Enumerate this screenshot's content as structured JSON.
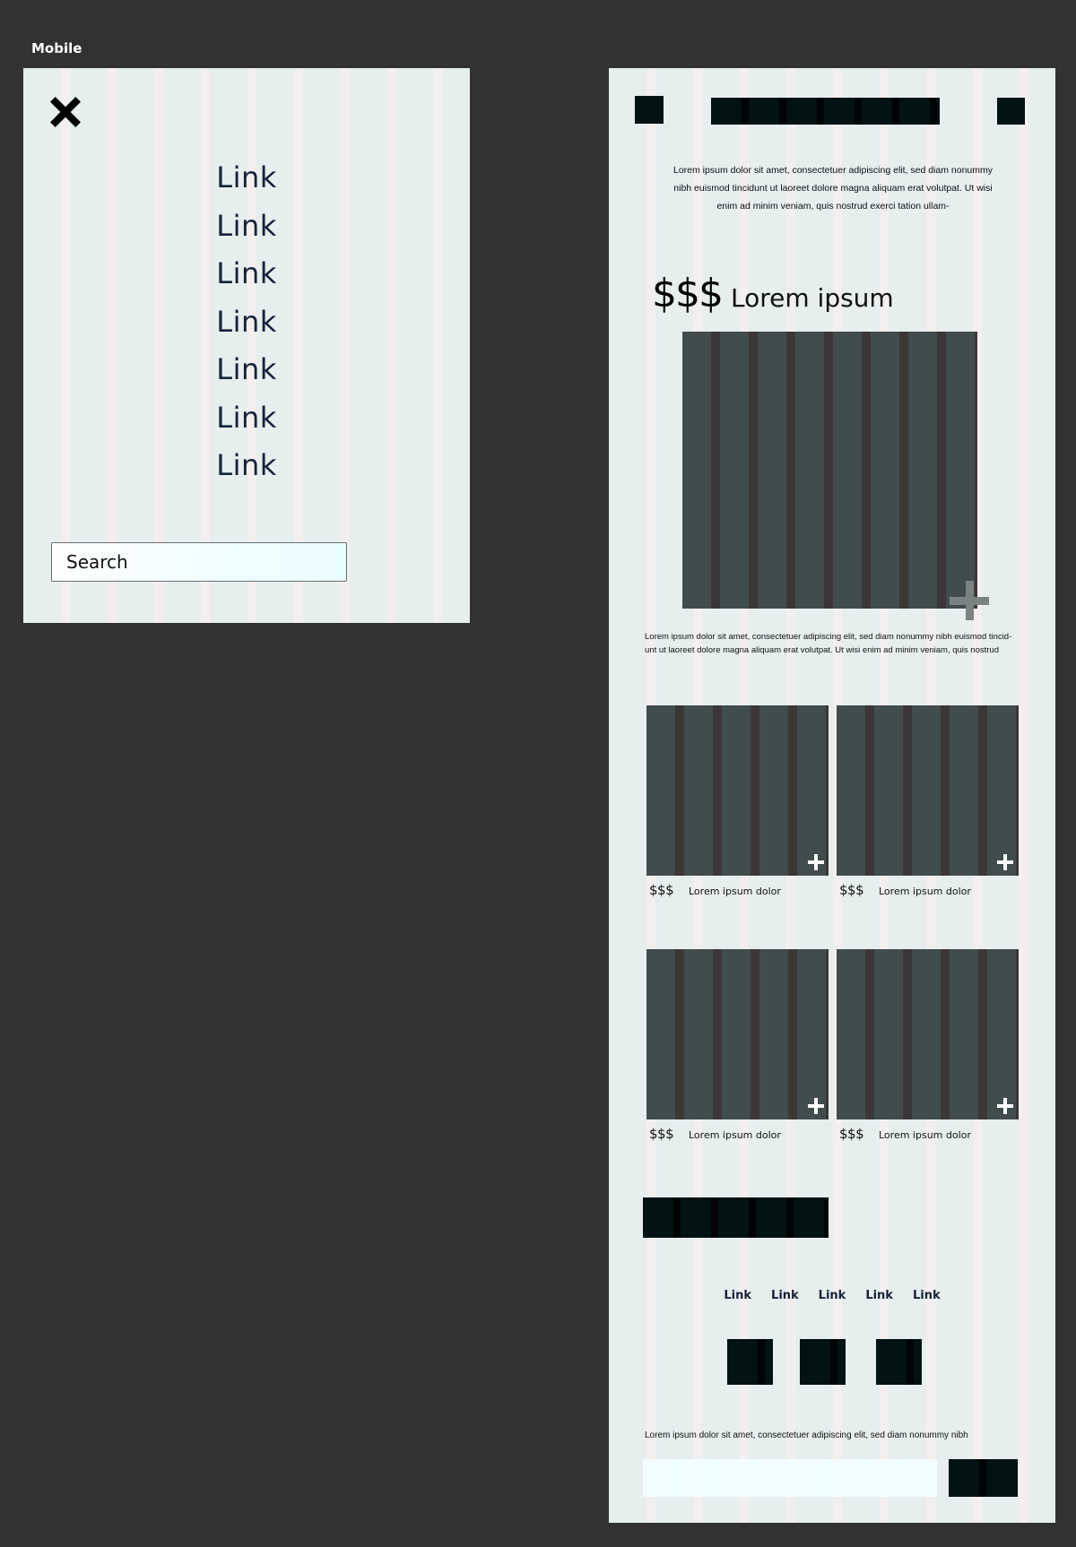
{
  "frame": {
    "label": "Mobile"
  },
  "menu": {
    "links": [
      "Link",
      "Link",
      "Link",
      "Link",
      "Link",
      "Link",
      "Link"
    ],
    "search": {
      "placeholder": "Search"
    }
  },
  "page": {
    "intro": "Lorem ipsum dolor sit amet, consectetuer adipiscing elit, sed diam nonummy nibh euismod tincidunt ut laoreet dolore magna aliquam erat volutpat. Ut wisi enim ad minim veniam, quis nostrud exerci tation ullam-",
    "featured": {
      "price": "$$$",
      "title": "Lorem ipsum",
      "description": "Lorem ipsum dolor sit amet, consectetuer adipiscing elit, sed diam nonummy nibh euismod tincid-unt ut laoreet dolore magna aliquam erat volutpat. Ut wisi enim ad minim veniam, quis nostrud"
    },
    "products": [
      {
        "price": "$$$",
        "name": "Lorem ipsum dolor"
      },
      {
        "price": "$$$",
        "name": "Lorem ipsum dolor"
      },
      {
        "price": "$$$",
        "name": "Lorem ipsum dolor"
      },
      {
        "price": "$$$",
        "name": "Lorem ipsum dolor"
      }
    ],
    "footer": {
      "links": [
        "Link",
        "Link",
        "Link",
        "Link",
        "Link"
      ],
      "text": "Lorem ipsum dolor sit amet, consectetuer adipiscing elit, sed diam nonummy nibh"
    }
  },
  "colors": {
    "canvas": "#323232",
    "artboard": "#e6eeee",
    "placeholder_block": "#031212",
    "image_placeholder": "#414d4d",
    "link_text": "#15233a"
  },
  "icons": {
    "close": "close-icon",
    "add": "plus-icon"
  }
}
